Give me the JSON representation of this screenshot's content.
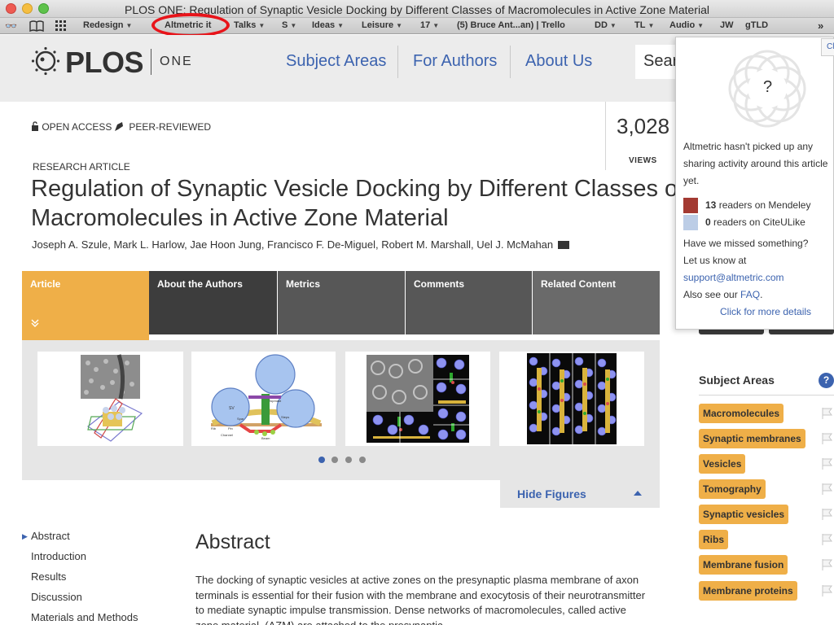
{
  "window": {
    "title": "PLOS ONE: Regulation of Synaptic Vesicle Docking by Different Classes of Macromolecules in Active Zone Material"
  },
  "bookmarks": {
    "items": [
      {
        "label": "Redesign",
        "dropdown": true
      },
      {
        "label": "Altmetric it",
        "dropdown": false,
        "highlighted": true
      },
      {
        "label": "Talks",
        "dropdown": true
      },
      {
        "label": "S",
        "dropdown": true
      },
      {
        "label": "Ideas",
        "dropdown": true
      },
      {
        "label": "Leisure",
        "dropdown": true
      },
      {
        "label": "17",
        "dropdown": true
      },
      {
        "label": "(5) Bruce Ant...an) | Trello",
        "dropdown": false
      },
      {
        "label": "DD",
        "dropdown": true
      },
      {
        "label": "TL",
        "dropdown": true
      },
      {
        "label": "Audio",
        "dropdown": true
      },
      {
        "label": "JW",
        "dropdown": false
      },
      {
        "label": "gTLD",
        "dropdown": false
      }
    ],
    "overflow": "»",
    "highlight_color": "#e8141a"
  },
  "header": {
    "logo_word": "PLOS",
    "logo_sub": "ONE",
    "nav": [
      "Subject Areas",
      "For Authors",
      "About Us"
    ],
    "search_placeholder": "Sear"
  },
  "article": {
    "open_access": "OPEN ACCESS",
    "peer_reviewed": "PEER-REVIEWED",
    "views_count": "3,028",
    "views_label": "VIEWS",
    "type": "RESEARCH ARTICLE",
    "title_line1": "Regulation of Synaptic Vesicle Docking by Different Classes o",
    "title_line2": "Macromolecules in Active Zone Material",
    "authors": "Joseph A. Szule,  Mark L. Harlow,  Jae Hoon Jung,  Francisco F. De-Miguel,  Robert M. Marshall,  Uel J. McMahan"
  },
  "tabs": [
    {
      "label": "Article",
      "active": true
    },
    {
      "label": "About the Authors",
      "active": false
    },
    {
      "label": "Metrics",
      "active": false
    },
    {
      "label": "Comments",
      "active": false
    },
    {
      "label": "Related Content",
      "active": false
    }
  ],
  "figures": {
    "count": 4,
    "active_index": 0,
    "hide_label": "Hide Figures",
    "fig2_labels": [
      "SV",
      "Topmast",
      "Steps",
      "Spar",
      "Pin",
      "Beam",
      "Channel",
      "Rib"
    ]
  },
  "toc": {
    "items": [
      "Abstract",
      "Introduction",
      "Results",
      "Discussion",
      "Materials and Methods"
    ],
    "active": "Abstract"
  },
  "abstract": {
    "heading": "Abstract",
    "body": "The docking of synaptic vesicles at active zones on the presynaptic plasma membrane of axon terminals is essential for their fusion with the membrane and exocytosis of their neurotransmitter to mediate synaptic impulse transmission. Dense networks of macromolecules, called active zone material, (AZM) are attached to the presynaptic"
  },
  "subject_areas": {
    "heading": "Subject Areas",
    "help": "?",
    "tags": [
      "Macromolecules",
      "Synaptic membranes",
      "Vesicles",
      "Tomography",
      "Synaptic vesicles",
      "Ribs",
      "Membrane fusion",
      "Membrane proteins"
    ]
  },
  "altmetric_popup": {
    "close_label": "Cl",
    "donut_center": "?",
    "message": "Altmetric hasn't picked up any sharing activity around this article yet.",
    "readers": [
      {
        "count": "13",
        "source": "readers on Mendeley",
        "color": "#a33a32"
      },
      {
        "count": "0",
        "source": "readers on CiteULike",
        "color": "#bccde6"
      }
    ],
    "missed_line1": "Have we missed something?",
    "missed_line2": "Let us know at",
    "email": "support@altmetric.com",
    "also_see": "Also see our ",
    "faq": "FAQ",
    "more_details": "Click for more details"
  },
  "colors": {
    "accent_blue": "#3c63af",
    "tag_orange": "#efaf48",
    "header_gray": "#ececec"
  }
}
